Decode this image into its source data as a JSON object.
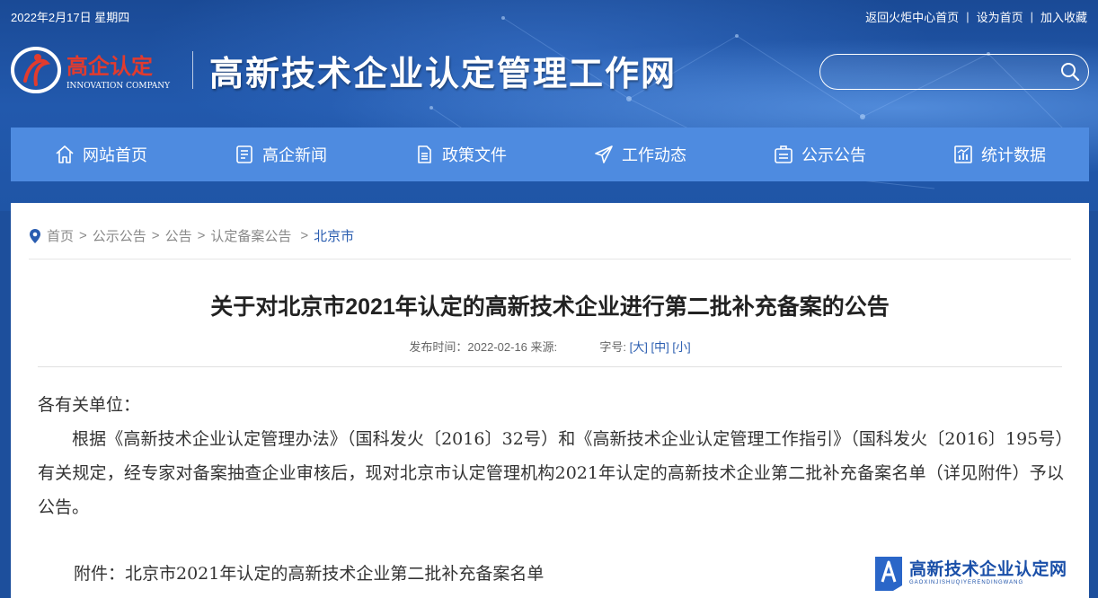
{
  "topbar": {
    "date": "2022年2月17日 星期四",
    "links": [
      "返回火炬中心首页",
      "设为首页",
      "加入收藏"
    ],
    "separator": "|"
  },
  "brand": {
    "logo_text": "高企认定",
    "logo_sub": "INNOVATION COMPANY",
    "site_title": "高新技术企业认定管理工作网"
  },
  "search": {
    "placeholder": ""
  },
  "nav": {
    "items": [
      {
        "label": "网站首页",
        "icon": "home-icon"
      },
      {
        "label": "高企新闻",
        "icon": "document-icon"
      },
      {
        "label": "政策文件",
        "icon": "file-text-icon"
      },
      {
        "label": "工作动态",
        "icon": "paper-plane-icon"
      },
      {
        "label": "公示公告",
        "icon": "bulletin-icon"
      },
      {
        "label": "统计数据",
        "icon": "chart-icon"
      }
    ]
  },
  "breadcrumb": {
    "items": [
      "首页",
      "公示公告",
      "公告",
      "认定备案公告"
    ],
    "current": "北京市",
    "arrow": ">"
  },
  "article": {
    "title": "关于对北京市2021年认定的高新技术企业进行第二批补充备案的公告",
    "meta_published": "发布时间：2022-02-16 来源:",
    "meta_fontsize": "字号:",
    "size_large": "[大]",
    "size_medium": "[中]",
    "size_small": "[小]",
    "salutation": "各有关单位：",
    "paragraph": "根据《高新技术企业认定管理办法》（国科发火〔2016〕32号）和《高新技术企业认定管理工作指引》（国科发火〔2016〕195号）有关规定，经专家对备案抽查企业审核后，现对北京市认定管理机构2021年认定的高新技术企业第二批补充备案名单（详见附件）予以公告。",
    "attachment": "附件：北京市2021年认定的高新技术企业第二批补充备案名单"
  },
  "watermark": {
    "title": "高新技术企业认定网",
    "sub": "GAOXINJISHUQIYERENDINGWANG"
  },
  "colors": {
    "header_bg": "#1f55a6",
    "nav_bg": "#4e8be0",
    "link": "#2a5db0",
    "logo_red": "#e23b2e"
  }
}
